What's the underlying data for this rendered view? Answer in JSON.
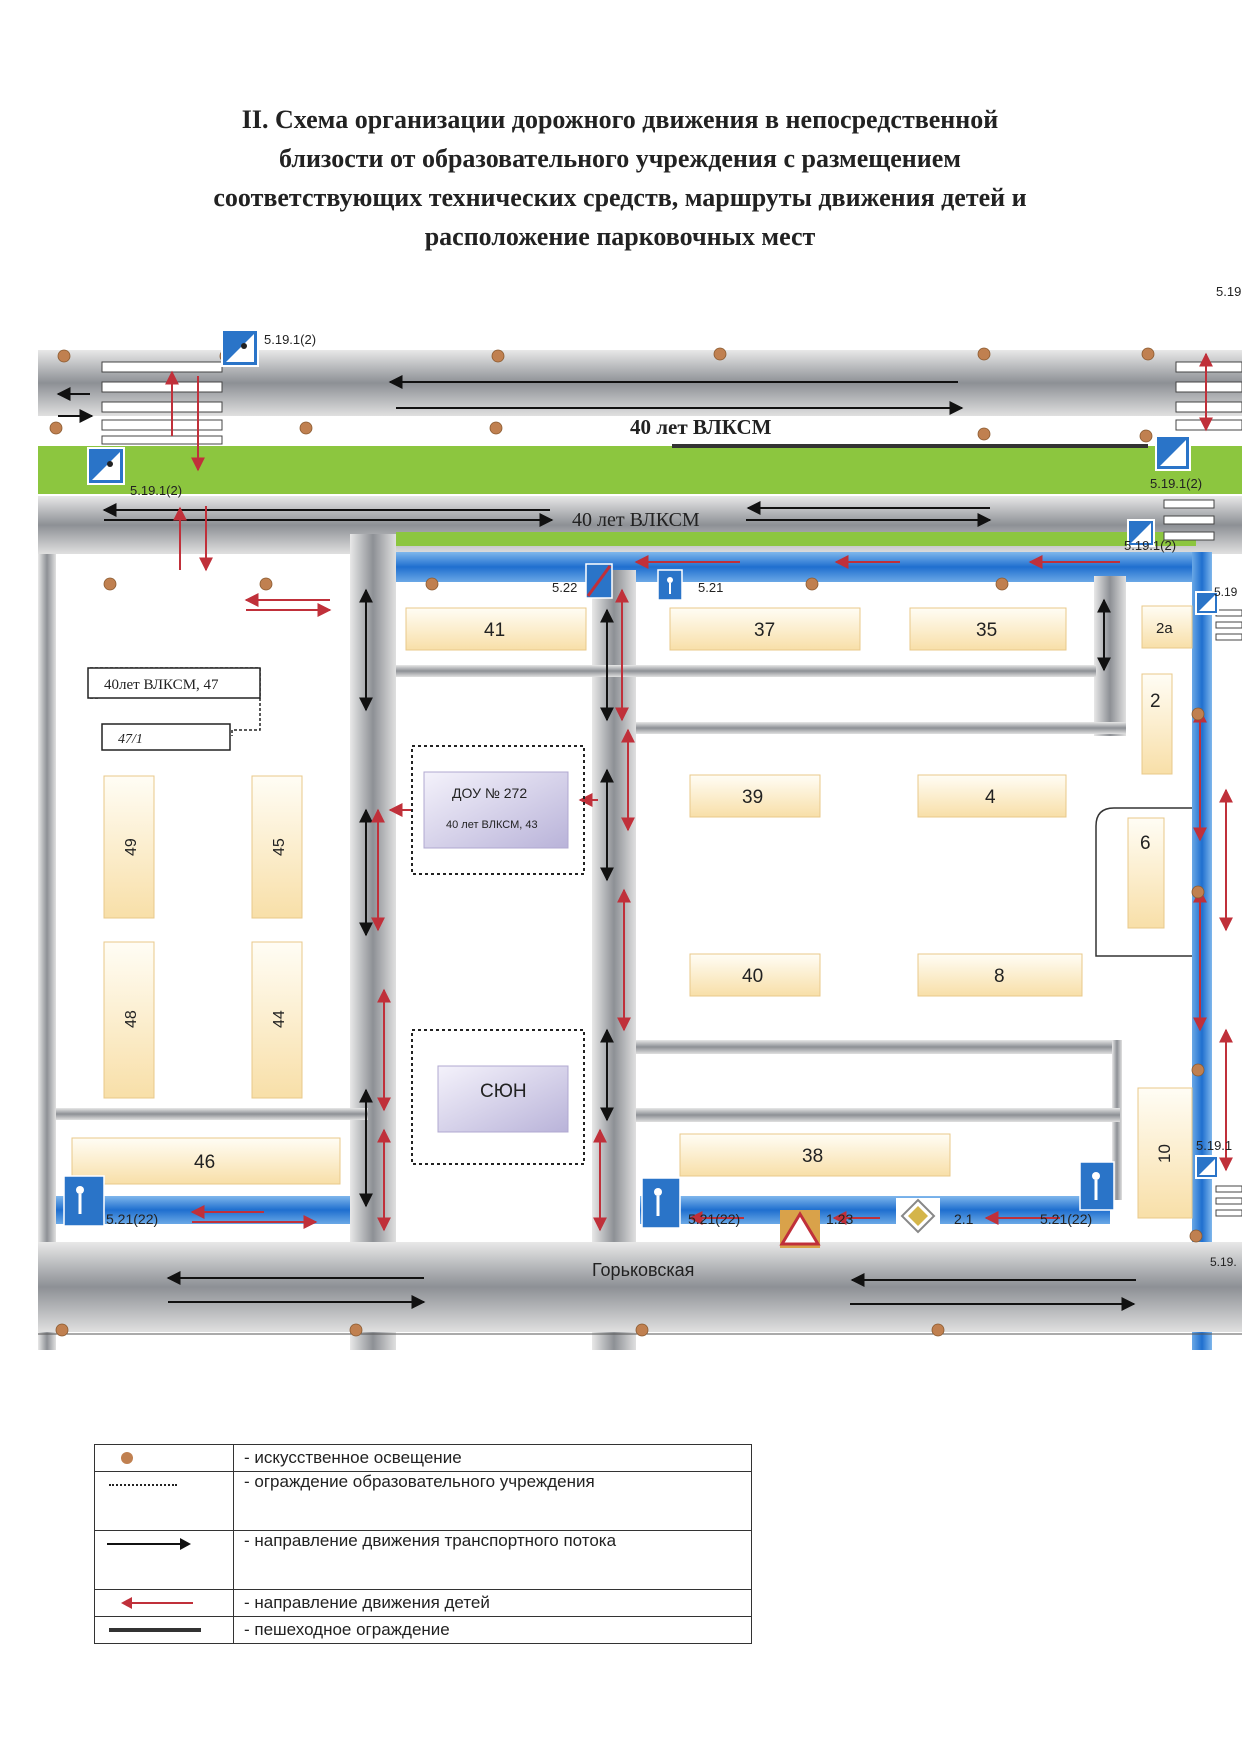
{
  "title_lines": [
    "II. Схема организации дорожного движения в непосредственной",
    "близости от образовательного учреждения с размещением",
    "соответствующих технических средств, маршруты движения детей и",
    "расположение парковочных мест"
  ],
  "streets": {
    "top": "40 лет ВЛКСМ",
    "inner": "40 лет ВЛКСМ",
    "bottom": "Горьковская"
  },
  "buildings": [
    "41",
    "37",
    "35",
    "2а",
    "2",
    "39",
    "4",
    "6",
    "40",
    "8",
    "38",
    "10",
    "49",
    "45",
    "48",
    "44",
    "46"
  ],
  "address_labels": {
    "house_47": "40лет ВЛКСМ, 47",
    "house_47_1": "47/1"
  },
  "institutions": {
    "dou_name": "ДОУ  № 272",
    "dou_address": "40 лет ВЛКСМ, 43",
    "syun": "СЮН"
  },
  "sign_codes": {
    "top_left_a": "5.19.1(2)",
    "top_left_b": "5.19.1(2)",
    "mid_522": "5.22",
    "mid_521": "5.21",
    "bottom_left": "5.21(22)",
    "bottom_mid": "5.21(22)",
    "sign_123": "1.23",
    "sign_21": "2.1",
    "bottom_right": "5.21(22)",
    "right_top": "5.19",
    "right_a": "5.19.1(2)",
    "right_b": "5.19.1(2)",
    "right_c": "5.19",
    "right_d": "5.19.1",
    "right_e": "5.19."
  },
  "legend": [
    {
      "symbol": "lighting-dot-icon",
      "text": "- искусственное освещение"
    },
    {
      "symbol": "dotted-line-icon",
      "text": "- ограждение образовательного учреждения"
    },
    {
      "symbol": "black-arrow-icon",
      "text": "- направление движения транспортного потока"
    },
    {
      "symbol": "red-arrow-icon",
      "text": "- направление движения детей"
    },
    {
      "symbol": "fence-line-icon",
      "text": "- пешеходное ограждение"
    }
  ],
  "colors": {
    "road": "#9a9c9f",
    "grass": "#8cc63f",
    "sidewalk": "#2f7fd0",
    "building": "#fbe7bd",
    "children_route": "#c0303a",
    "lamp": "#c08050"
  }
}
